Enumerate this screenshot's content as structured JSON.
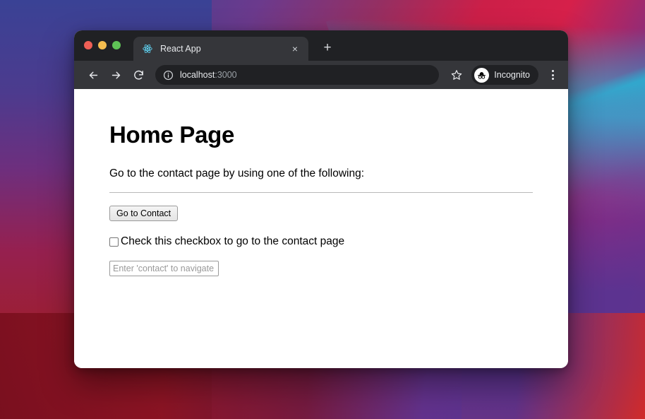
{
  "window": {
    "traffic_lights": [
      {
        "name": "close",
        "color": "#ef5f56"
      },
      {
        "name": "minimize",
        "color": "#f5bd4f"
      },
      {
        "name": "maximize",
        "color": "#5fc356"
      }
    ]
  },
  "tab_strip": {
    "active_tab": {
      "title": "React App",
      "favicon": "react-logo-icon",
      "close_label": "×"
    },
    "new_tab_label": "+"
  },
  "toolbar": {
    "back_icon": "arrow-left-icon",
    "forward_icon": "arrow-right-icon",
    "reload_icon": "reload-icon",
    "site_info_icon": "info-circle-icon",
    "url_host": "localhost",
    "url_port": ":3000",
    "bookmark_icon": "star-icon",
    "incognito_label": "Incognito",
    "incognito_icon": "incognito-hat-glasses-icon",
    "menu_icon": "three-dot-menu-icon"
  },
  "page": {
    "heading": "Home Page",
    "description": "Go to the contact page by using one of the following:",
    "button_label": "Go to Contact",
    "checkbox_label": "Check this checkbox to go to the contact page",
    "checkbox_checked": false,
    "input_value": "",
    "input_placeholder": "Enter 'contact' to navigate"
  },
  "colors": {
    "browser_chrome": "#35363a",
    "tab_strip": "#202124",
    "omnibox": "#202124",
    "page_background": "#ffffff",
    "text_primary": "#000000",
    "url_host_color": "#e8eaed",
    "url_port_color": "#9aa0a6"
  }
}
